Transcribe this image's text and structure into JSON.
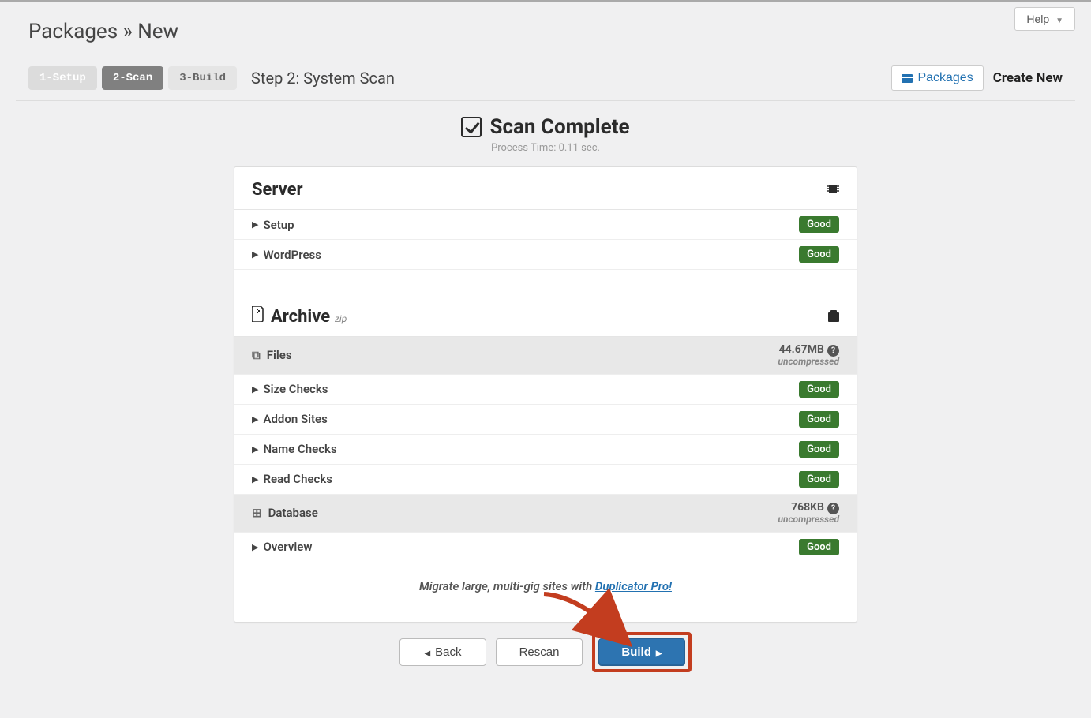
{
  "help_label": "Help",
  "page_title": "Packages » New",
  "steps": {
    "s1": "1-Setup",
    "s2": "2-Scan",
    "s3": "3-Build",
    "current_label": "Step 2: System Scan"
  },
  "nav": {
    "packages": "Packages",
    "create_new": "Create New"
  },
  "scan": {
    "title": "Scan Complete",
    "process_time": "Process Time: 0.11 sec."
  },
  "server": {
    "title": "Server",
    "items": [
      {
        "label": "Setup",
        "status": "Good"
      },
      {
        "label": "WordPress",
        "status": "Good"
      }
    ]
  },
  "archive": {
    "title": "Archive",
    "format": "zip",
    "files": {
      "title": "Files",
      "size": "44.67MB",
      "note": "uncompressed",
      "items": [
        {
          "label": "Size Checks",
          "status": "Good"
        },
        {
          "label": "Addon Sites",
          "status": "Good"
        },
        {
          "label": "Name Checks",
          "status": "Good"
        },
        {
          "label": "Read Checks",
          "status": "Good"
        }
      ]
    },
    "database": {
      "title": "Database",
      "size": "768KB",
      "note": "uncompressed",
      "items": [
        {
          "label": "Overview",
          "status": "Good"
        }
      ]
    }
  },
  "promo": {
    "pre": "Migrate large, multi-gig sites with ",
    "link": "Duplicator Pro!"
  },
  "buttons": {
    "back": "Back",
    "rescan": "Rescan",
    "build": "Build"
  },
  "colors": {
    "good_badge": "#3a7a2f",
    "primary_btn": "#2d74b1",
    "highlight_border": "#c33d1f",
    "link": "#2271b1"
  }
}
